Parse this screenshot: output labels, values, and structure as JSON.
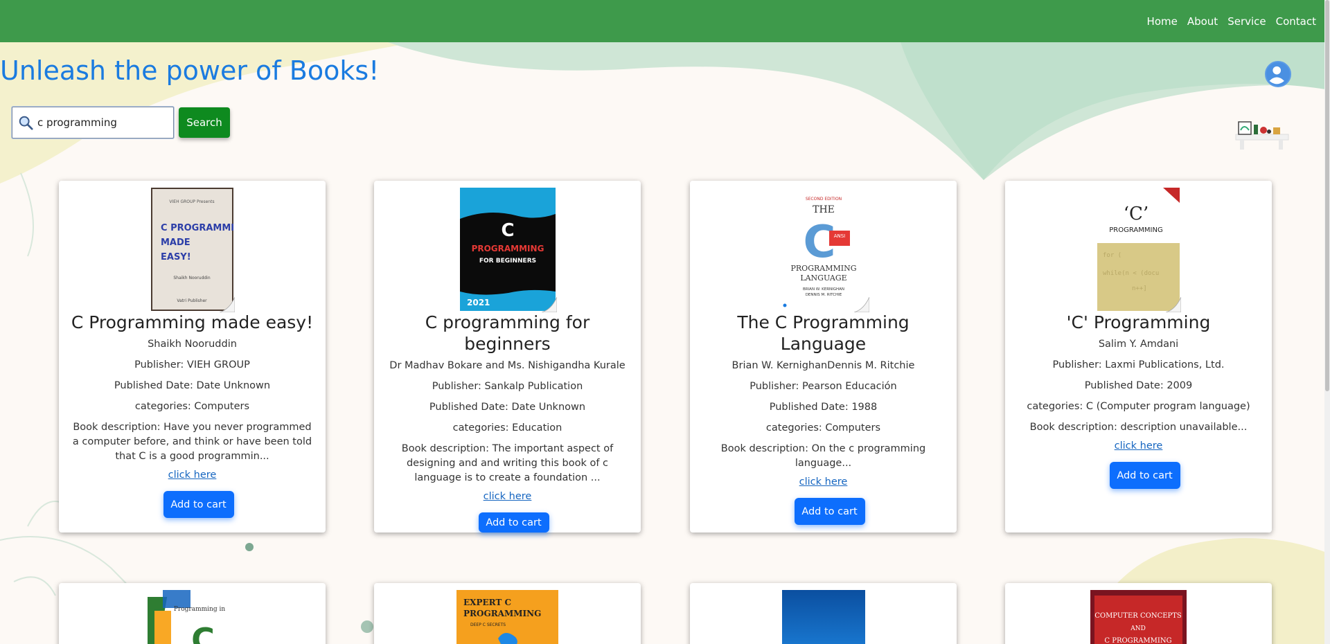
{
  "nav": {
    "items": [
      "Home",
      "About",
      "Service",
      "Contact"
    ]
  },
  "header": {
    "title": "Unleash the power of Books!"
  },
  "search": {
    "value": "c programming",
    "button_label": "Search"
  },
  "books": [
    {
      "title": "C Programming made easy!",
      "author": "Shaikh Nooruddin",
      "publisher": "Publisher: VIEH GROUP",
      "published": "Published Date: Date Unknown",
      "categories": "categories: Computers",
      "description": "Book description: Have you never programmed a computer before, and think or have been told that C is a good programmin...",
      "link": "click here",
      "button": "Add to cart",
      "cover_lines": [
        "VIEH GROUP Presents",
        "C PROGRAMMING",
        "MADE",
        "EASY!",
        "Shaikh Nooruddin",
        "Vatri Publisher"
      ]
    },
    {
      "title": "C programming for beginners",
      "author": "Dr Madhav Bokare and Ms. Nishigandha Kurale",
      "publisher": "Publisher: Sankalp Publication",
      "published": "Published Date: Date Unknown",
      "categories": "categories: Education",
      "description": "Book description: The important aspect of designing and and writing this book of c language is to create a foundation ...",
      "link": "click here",
      "button": "Add to cart",
      "cover_lines": [
        "C",
        "PROGRAMMING",
        "FOR BEGINNERS",
        "2021"
      ]
    },
    {
      "title": "The C Programming Language",
      "author": "Brian W. KernighanDennis M. Ritchie",
      "publisher": "Publisher: Pearson Educación",
      "published": "Published Date: 1988",
      "categories": "categories: Computers",
      "description": "Book description: On the c programming language...",
      "link": "click here",
      "button": "Add to cart",
      "cover_lines": [
        "SECOND EDITION",
        "THE",
        "C",
        "ANSI",
        "PROGRAMMING",
        "LANGUAGE",
        "BRIAN W. KERNIGHAN",
        "DENNIS M. RITCHIE"
      ]
    },
    {
      "title": "'C' Programming",
      "author": "Salim Y. Amdani",
      "publisher": "Publisher: Laxmi Publications, Ltd.",
      "published": "Published Date: 2009",
      "categories": "categories: C (Computer program language)",
      "description": "Book description: description unavailable...",
      "link": "click here",
      "button": "Add to cart",
      "cover_lines": [
        "‘C’",
        "PROGRAMMING"
      ]
    }
  ],
  "books_row2": [
    {
      "cover_lines": [
        "Programming in",
        "C"
      ]
    },
    {
      "cover_lines": [
        "EXPERT C",
        "PROGRAMMING",
        "DEEP C SECRETS"
      ]
    },
    {
      "cover_lines": []
    },
    {
      "cover_lines": [
        "COMPUTER CONCEPTS",
        "AND",
        "C PROGRAMMING"
      ]
    }
  ],
  "colors": {
    "nav_bg": "#3e9a4b",
    "title": "#1a7be0",
    "search_button": "#0e8a1f",
    "cart_button": "#0d6efd"
  }
}
